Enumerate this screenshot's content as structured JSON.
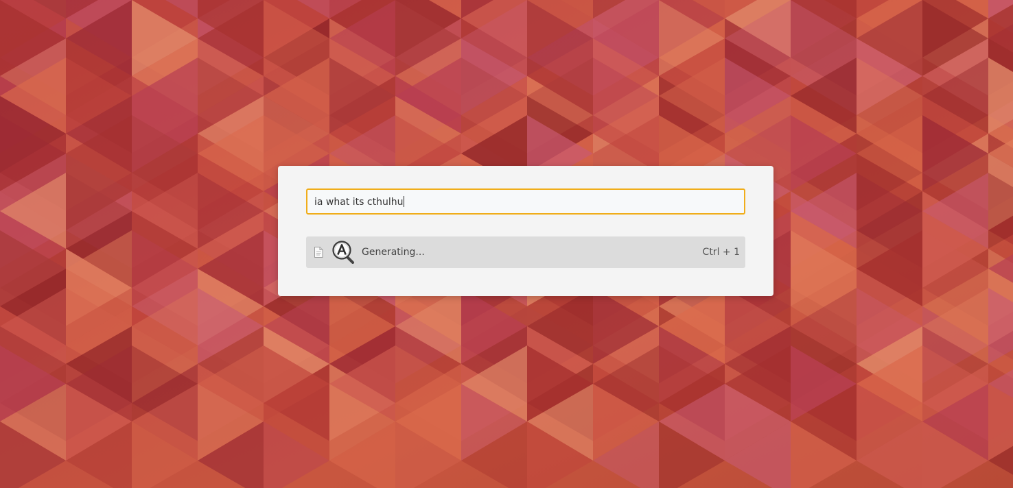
{
  "colors": {
    "accent": "#f0ad1a",
    "panel": "#f4f4f4",
    "result_highlight": "#dcdcdc"
  },
  "search": {
    "value": "ia what its cthulhu"
  },
  "results": [
    {
      "label": "Generating...",
      "shortcut": "Ctrl + 1",
      "icons": [
        "text-document-icon",
        "accessibility-magnifier-icon"
      ]
    }
  ]
}
